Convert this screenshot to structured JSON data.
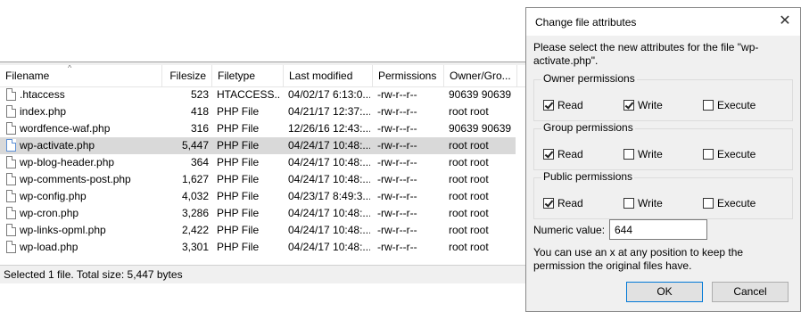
{
  "file_list": {
    "columns": [
      "Filename",
      "Filesize",
      "Filetype",
      "Last modified",
      "Permissions",
      "Owner/Gro..."
    ],
    "rows": [
      {
        "name": ".htaccess",
        "size": "523",
        "type": "HTACCESS...",
        "modified": "04/02/17 6:13:0...",
        "permissions": "-rw-r--r--",
        "owner": "90639 90639"
      },
      {
        "name": "index.php",
        "size": "418",
        "type": "PHP File",
        "modified": "04/21/17 12:37:...",
        "permissions": "-rw-r--r--",
        "owner": "root root"
      },
      {
        "name": "wordfence-waf.php",
        "size": "316",
        "type": "PHP File",
        "modified": "12/26/16 12:43:...",
        "permissions": "-rw-r--r--",
        "owner": "90639 90639"
      },
      {
        "name": "wp-activate.php",
        "size": "5,447",
        "type": "PHP File",
        "modified": "04/24/17 10:48:...",
        "permissions": "-rw-r--r--",
        "owner": "root root"
      },
      {
        "name": "wp-blog-header.php",
        "size": "364",
        "type": "PHP File",
        "modified": "04/24/17 10:48:...",
        "permissions": "-rw-r--r--",
        "owner": "root root"
      },
      {
        "name": "wp-comments-post.php",
        "size": "1,627",
        "type": "PHP File",
        "modified": "04/24/17 10:48:...",
        "permissions": "-rw-r--r--",
        "owner": "root root"
      },
      {
        "name": "wp-config.php",
        "size": "4,032",
        "type": "PHP File",
        "modified": "04/23/17 8:49:3...",
        "permissions": "-rw-r--r--",
        "owner": "root root"
      },
      {
        "name": "wp-cron.php",
        "size": "3,286",
        "type": "PHP File",
        "modified": "04/24/17 10:48:...",
        "permissions": "-rw-r--r--",
        "owner": "root root"
      },
      {
        "name": "wp-links-opml.php",
        "size": "2,422",
        "type": "PHP File",
        "modified": "04/24/17 10:48:...",
        "permissions": "-rw-r--r--",
        "owner": "root root"
      },
      {
        "name": "wp-load.php",
        "size": "3,301",
        "type": "PHP File",
        "modified": "04/24/17 10:48:...",
        "permissions": "-rw-r--r--",
        "owner": "root root"
      }
    ]
  },
  "status_bar": {
    "text": "Selected 1 file. Total size: 5,447 bytes"
  },
  "dialog": {
    "title": "Change file attributes",
    "prompt": "Please select the new attributes for the file \"wp-activate.php\".",
    "groups": [
      {
        "label": "Owner permissions",
        "read": "Read",
        "write": "Write",
        "execute": "Execute"
      },
      {
        "label": "Group permissions",
        "read": "Read",
        "write": "Write",
        "execute": "Execute"
      },
      {
        "label": "Public permissions",
        "read": "Read",
        "write": "Write",
        "execute": "Execute"
      }
    ],
    "checked": {
      "owner": {
        "read": true,
        "write": true,
        "execute": false
      },
      "group": {
        "read": true,
        "write": false,
        "execute": false
      },
      "public": {
        "read": true,
        "write": false,
        "execute": false
      }
    },
    "numeric_label": "Numeric value:",
    "numeric_value": "644",
    "hint": "You can use an x at any position to keep the permission the original files have.",
    "ok_label": "OK",
    "cancel_label": "Cancel"
  },
  "icons": {
    "close": "close-icon",
    "file": "file-icon",
    "sort": "sort-arrow-icon"
  },
  "colors": {
    "selection": "#d9d9d9",
    "dialog_bg": "#f0f0f0",
    "default_button_border": "#0078d7"
  }
}
